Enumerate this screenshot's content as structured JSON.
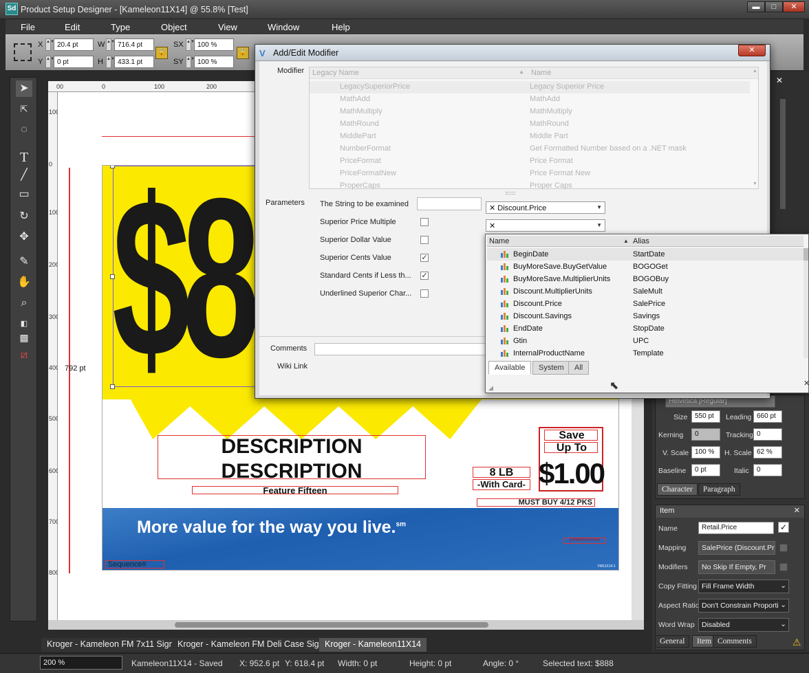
{
  "window": {
    "title": "Product Setup Designer - [Kameleon11X14] @ 55.8% [Test]",
    "icon": "Sd"
  },
  "menu": [
    "File",
    "Edit",
    "Type",
    "Object",
    "View",
    "Window",
    "Help"
  ],
  "toolbar": {
    "x_label": "X",
    "x_value": "20.4 pt",
    "y_label": "Y",
    "y_value": "0 pt",
    "w_label": "W",
    "w_value": "716.4 pt",
    "h_label": "H",
    "h_value": "433.1 pt",
    "sx_label": "SX",
    "sx_value": "100 %",
    "sy_label": "SY",
    "sy_value": "100 %"
  },
  "tools": [
    "select-arrow",
    "direct-select",
    "lasso",
    "type",
    "line",
    "rectangle",
    "rotate",
    "move",
    "eyedropper",
    "hand",
    "zoom",
    "fill-stroke",
    "swap",
    "none"
  ],
  "ruler": {
    "top": [
      "00",
      "0",
      "100",
      "200"
    ],
    "left": [
      "100",
      "0",
      "100",
      "200",
      "300",
      "400",
      "500",
      "600",
      "700",
      "800"
    ]
  },
  "artboard": {
    "price": "$888",
    "description_1": "DESCRIPTION",
    "description_2": "DESCRIPTION",
    "feature": "Feature Fifteen",
    "weight": "8 LB",
    "with_card": "-With Card-",
    "save": "Save",
    "up_to": "Up To",
    "save_amount": "$1.00",
    "must_buy": "MUST BUY 4/12 PKS",
    "tagline": "More value for the way you live.",
    "tagline_mark": "sm",
    "expiration": "EXPIRATION DATE",
    "sequence": "Sequence#",
    "size_label": "792 pt",
    "footer_code": "FM11X14-1"
  },
  "modal": {
    "title": "Add/Edit Modifier",
    "close": "✕",
    "modifier_label": "Modifier",
    "col_legacy": "Legacy Name",
    "col_name": "Name",
    "rows": [
      {
        "legacy": "LegacySuperiorPrice",
        "name": "Legacy Superior Price"
      },
      {
        "legacy": "MathAdd",
        "name": "MathAdd"
      },
      {
        "legacy": "MathMultiply",
        "name": "MathMultiply"
      },
      {
        "legacy": "MathRound",
        "name": "MathRound"
      },
      {
        "legacy": "MiddlePart",
        "name": "Middle Part"
      },
      {
        "legacy": "NumberFormat",
        "name": "Get Formatted Number based on a .NET mask"
      },
      {
        "legacy": "PriceFormat",
        "name": "Price Format"
      },
      {
        "legacy": "PriceFormatNew",
        "name": "Price Format New"
      },
      {
        "legacy": "ProperCaps",
        "name": "Proper Caps"
      }
    ],
    "parameters_label": "Parameters",
    "params": [
      {
        "label": "The String to be examined",
        "type": "text",
        "value": ""
      },
      {
        "label": "Superior Price Multiple",
        "type": "check",
        "checked": false
      },
      {
        "label": "Superior Dollar Value",
        "type": "check",
        "checked": false
      },
      {
        "label": "Superior Cents Value",
        "type": "check",
        "checked": true
      },
      {
        "label": "Standard Cents if Less th...",
        "type": "check",
        "checked": true
      },
      {
        "label": "Underlined Superior Char...",
        "type": "check",
        "checked": false
      }
    ],
    "combo1": "Discount.Price",
    "combo2": "",
    "comments_label": "Comments",
    "wiki_label": "Wiki Link"
  },
  "dropdown": {
    "col_name": "Name",
    "col_alias": "Alias",
    "rows": [
      {
        "name": "BeginDate",
        "alias": "StartDate"
      },
      {
        "name": "BuyMoreSave.BuyGetValue",
        "alias": "BOGOGet"
      },
      {
        "name": "BuyMoreSave.MultiplierUnits",
        "alias": "BOGOBuy"
      },
      {
        "name": "Discount.MultiplierUnits",
        "alias": "SaleMult"
      },
      {
        "name": "Discount.Price",
        "alias": "SalePrice"
      },
      {
        "name": "Discount.Savings",
        "alias": "Savings"
      },
      {
        "name": "EndDate",
        "alias": "StopDate"
      },
      {
        "name": "Gtin",
        "alias": "UPC"
      },
      {
        "name": "InternalProductName",
        "alias": "Template"
      }
    ],
    "tabs": [
      "Available",
      "System",
      "All"
    ]
  },
  "character": {
    "size_label": "Size",
    "size": "550 pt",
    "leading_label": "Leading",
    "leading": "660 pt",
    "kerning_label": "Kerning",
    "kerning": "0",
    "tracking_label": "Tracking",
    "tracking": "0",
    "vscale_label": "V. Scale",
    "vscale": "100 %",
    "hscale_label": "H. Scale",
    "hscale": "62 %",
    "baseline_label": "Baseline",
    "baseline": "0 pt",
    "italic_label": "Italic",
    "italic": "0",
    "tab_character": "Character",
    "tab_paragraph": "Paragraph",
    "font_partial": "Helvetica [Regular]"
  },
  "item": {
    "title": "Item",
    "name_label": "Name",
    "name": "Retail.Price",
    "mapping_label": "Mapping",
    "mapping": "SalePrice (Discount.Pr",
    "modifiers_label": "Modifiers",
    "modifiers": "No Skip If Empty,  Pr",
    "copyfit_label": "Copy Fitting",
    "copyfit": "Fill Frame Width",
    "aspect_label": "Aspect Ratio",
    "aspect": "Don't Constrain Proporti",
    "wordwrap_label": "Word Wrap",
    "wordwrap": "Disabled",
    "tabs": [
      "General",
      "Item",
      "Comments"
    ]
  },
  "doc_tabs": [
    "Kroger - Kameleon FM 7x11 Sign",
    "Kroger - Kameleon FM Deli Case Sign",
    "Kroger - Kameleon11X14"
  ],
  "status": {
    "zoom": "200 %",
    "doc": "Kameleon11X14  - Saved",
    "x": "X: 952.6 pt",
    "y": "Y: 618.4 pt",
    "width": "Width: 0 pt",
    "height": "Height: 0 pt",
    "angle": "Angle: 0 °",
    "selected": "Selected text: $888"
  },
  "colors": {
    "yellow": "#fbe900",
    "blue": "#2463b4",
    "accent_red": "#e03030",
    "dark": "#2b2b2b"
  }
}
